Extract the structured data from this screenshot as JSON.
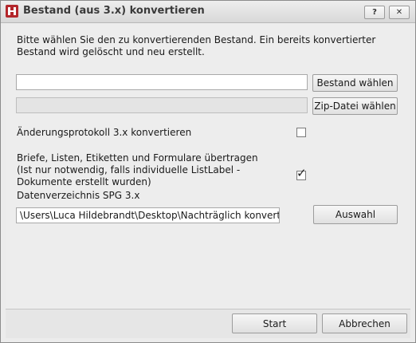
{
  "window": {
    "title": "Bestand (aus 3.x) konvertieren",
    "help_label": "?",
    "close_label": "✕"
  },
  "intro_text": "Bitte wählen Sie den zu konvertierenden Bestand. Ein bereits konvertierter Bestand wird gelöscht und neu erstellt.",
  "bestand": {
    "path_value": "",
    "button_label": "Bestand wählen"
  },
  "zip": {
    "path_value": "",
    "button_label": "Zip-Datei wählen"
  },
  "option_protokoll": {
    "label": "Änderungsprotokoll 3.x konvertieren",
    "checked": false
  },
  "option_briefe": {
    "label_line1": "Briefe, Listen, Etiketten und Formulare übertragen",
    "label_line2": "(Ist nur notwendig, falls individuelle ListLabel -",
    "label_line3": "Dokumente erstellt wurden)",
    "checked": true,
    "check_glyph": "✓"
  },
  "datenverzeichnis": {
    "label": "Datenverzeichnis SPG 3.x",
    "path_value": "\\Users\\Luca Hildebrandt\\Desktop\\Nachträglich konvertieren",
    "button_label": "Auswahl"
  },
  "footer": {
    "start_label": "Start",
    "cancel_label": "Abbrechen"
  }
}
